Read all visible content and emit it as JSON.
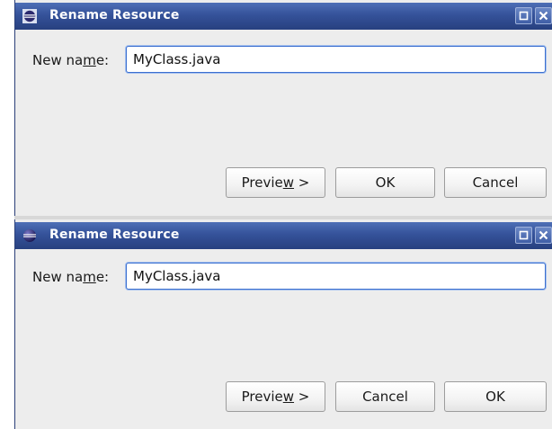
{
  "colors": {
    "title_bar": "#35529a",
    "dialog_bg": "#ededed",
    "input_border": "#3b6fcf"
  },
  "dialog_top": {
    "title": "Rename Resource",
    "icon": "eclipse-icon",
    "name_label_pre": "New na",
    "name_label_mnemonic": "m",
    "name_label_post": "e:",
    "name_value": "MyClass.java",
    "preview_pre": "Previe",
    "preview_mnemonic": "w",
    "preview_post": " >",
    "button_2": "OK",
    "button_3": "Cancel"
  },
  "dialog_bottom": {
    "title": "Rename Resource",
    "icon": "eclipse-sphere-icon",
    "name_label_pre": "New na",
    "name_label_mnemonic": "m",
    "name_label_post": "e:",
    "name_value": "MyClass.java",
    "preview_pre": "Previe",
    "preview_mnemonic": "w",
    "preview_post": " >",
    "button_2": "Cancel",
    "button_3": "OK"
  }
}
